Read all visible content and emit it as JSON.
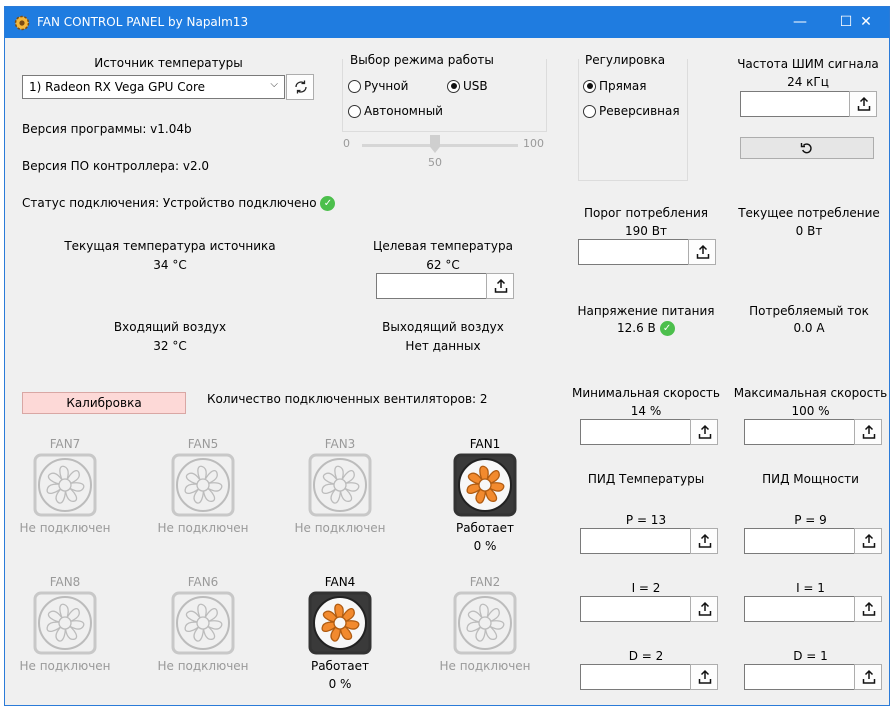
{
  "window": {
    "title": "FAN CONTROL PANEL by Napalm13"
  },
  "source": {
    "label": "Источник температуры",
    "selected": "1) Radeon RX Vega GPU Core"
  },
  "info": {
    "program_version": "Версия программы: v1.04b",
    "fw_version": "Версия ПО контроллера: v2.0",
    "status": "Статус подключения: Устройство подключено"
  },
  "mode": {
    "label": "Выбор режима работы",
    "manual": "Ручной",
    "usb": "USB",
    "auto": "Автономный",
    "selected": "USB",
    "slider_min": "0",
    "slider_max": "100",
    "slider_value": "50"
  },
  "regulation": {
    "label": "Регулировка",
    "direct": "Прямая",
    "reverse": "Реверсивная",
    "selected": "Прямая"
  },
  "pwm": {
    "label": "Частота ШИМ сигнала",
    "value": "24 кГц"
  },
  "temps": {
    "current_label": "Текущая температура источника",
    "current_value": "34 °C",
    "target_label": "Целевая температура",
    "target_value": "62 °C",
    "intake_label": "Входящий воздух",
    "intake_value": "32 °C",
    "exhaust_label": "Выходящий воздух",
    "exhaust_value": "Нет данных"
  },
  "power": {
    "threshold_label": "Порог потребления",
    "threshold_value": "190 Вт",
    "current_label": "Текущее потребление",
    "current_value": "0 Вт",
    "voltage_label": "Напряжение питания",
    "voltage_value": "12.6 В",
    "amp_label": "Потребляемый ток",
    "amp_value": "0.0 А"
  },
  "speed": {
    "min_label": "Минимальная скорость",
    "min_value": "14 %",
    "max_label": "Максимальная скорость",
    "max_value": "100 %"
  },
  "pid": {
    "temp_label": "ПИД Температуры",
    "power_label": "ПИД Мощности",
    "tp": "P = 13",
    "ti": "I = 2",
    "td": "D = 2",
    "pp": "P = 9",
    "pi": "I = 1",
    "pd": "D = 1"
  },
  "calibration": {
    "label": "Калибровка",
    "fans_count": "Количество подключенных вентиляторов: 2"
  },
  "fans": [
    {
      "name": "FAN7",
      "status": "Не подключен",
      "speed": "",
      "active": false
    },
    {
      "name": "FAN5",
      "status": "Не подключен",
      "speed": "",
      "active": false
    },
    {
      "name": "FAN3",
      "status": "Не подключен",
      "speed": "",
      "active": false
    },
    {
      "name": "FAN1",
      "status": "Работает",
      "speed": "0 %",
      "active": true
    },
    {
      "name": "FAN8",
      "status": "Не подключен",
      "speed": "",
      "active": false
    },
    {
      "name": "FAN6",
      "status": "Не подключен",
      "speed": "",
      "active": false
    },
    {
      "name": "FAN4",
      "status": "Работает",
      "speed": "0 %",
      "active": true
    },
    {
      "name": "FAN2",
      "status": "Не подключен",
      "speed": "",
      "active": false
    }
  ],
  "colors": {
    "titlebar": "#1f7ce0",
    "fan_active": "#f28a2e",
    "fan_inactive": "#bcbcbc",
    "ok": "#4cbf4c",
    "calibration_bg": "#fdd9d7"
  }
}
